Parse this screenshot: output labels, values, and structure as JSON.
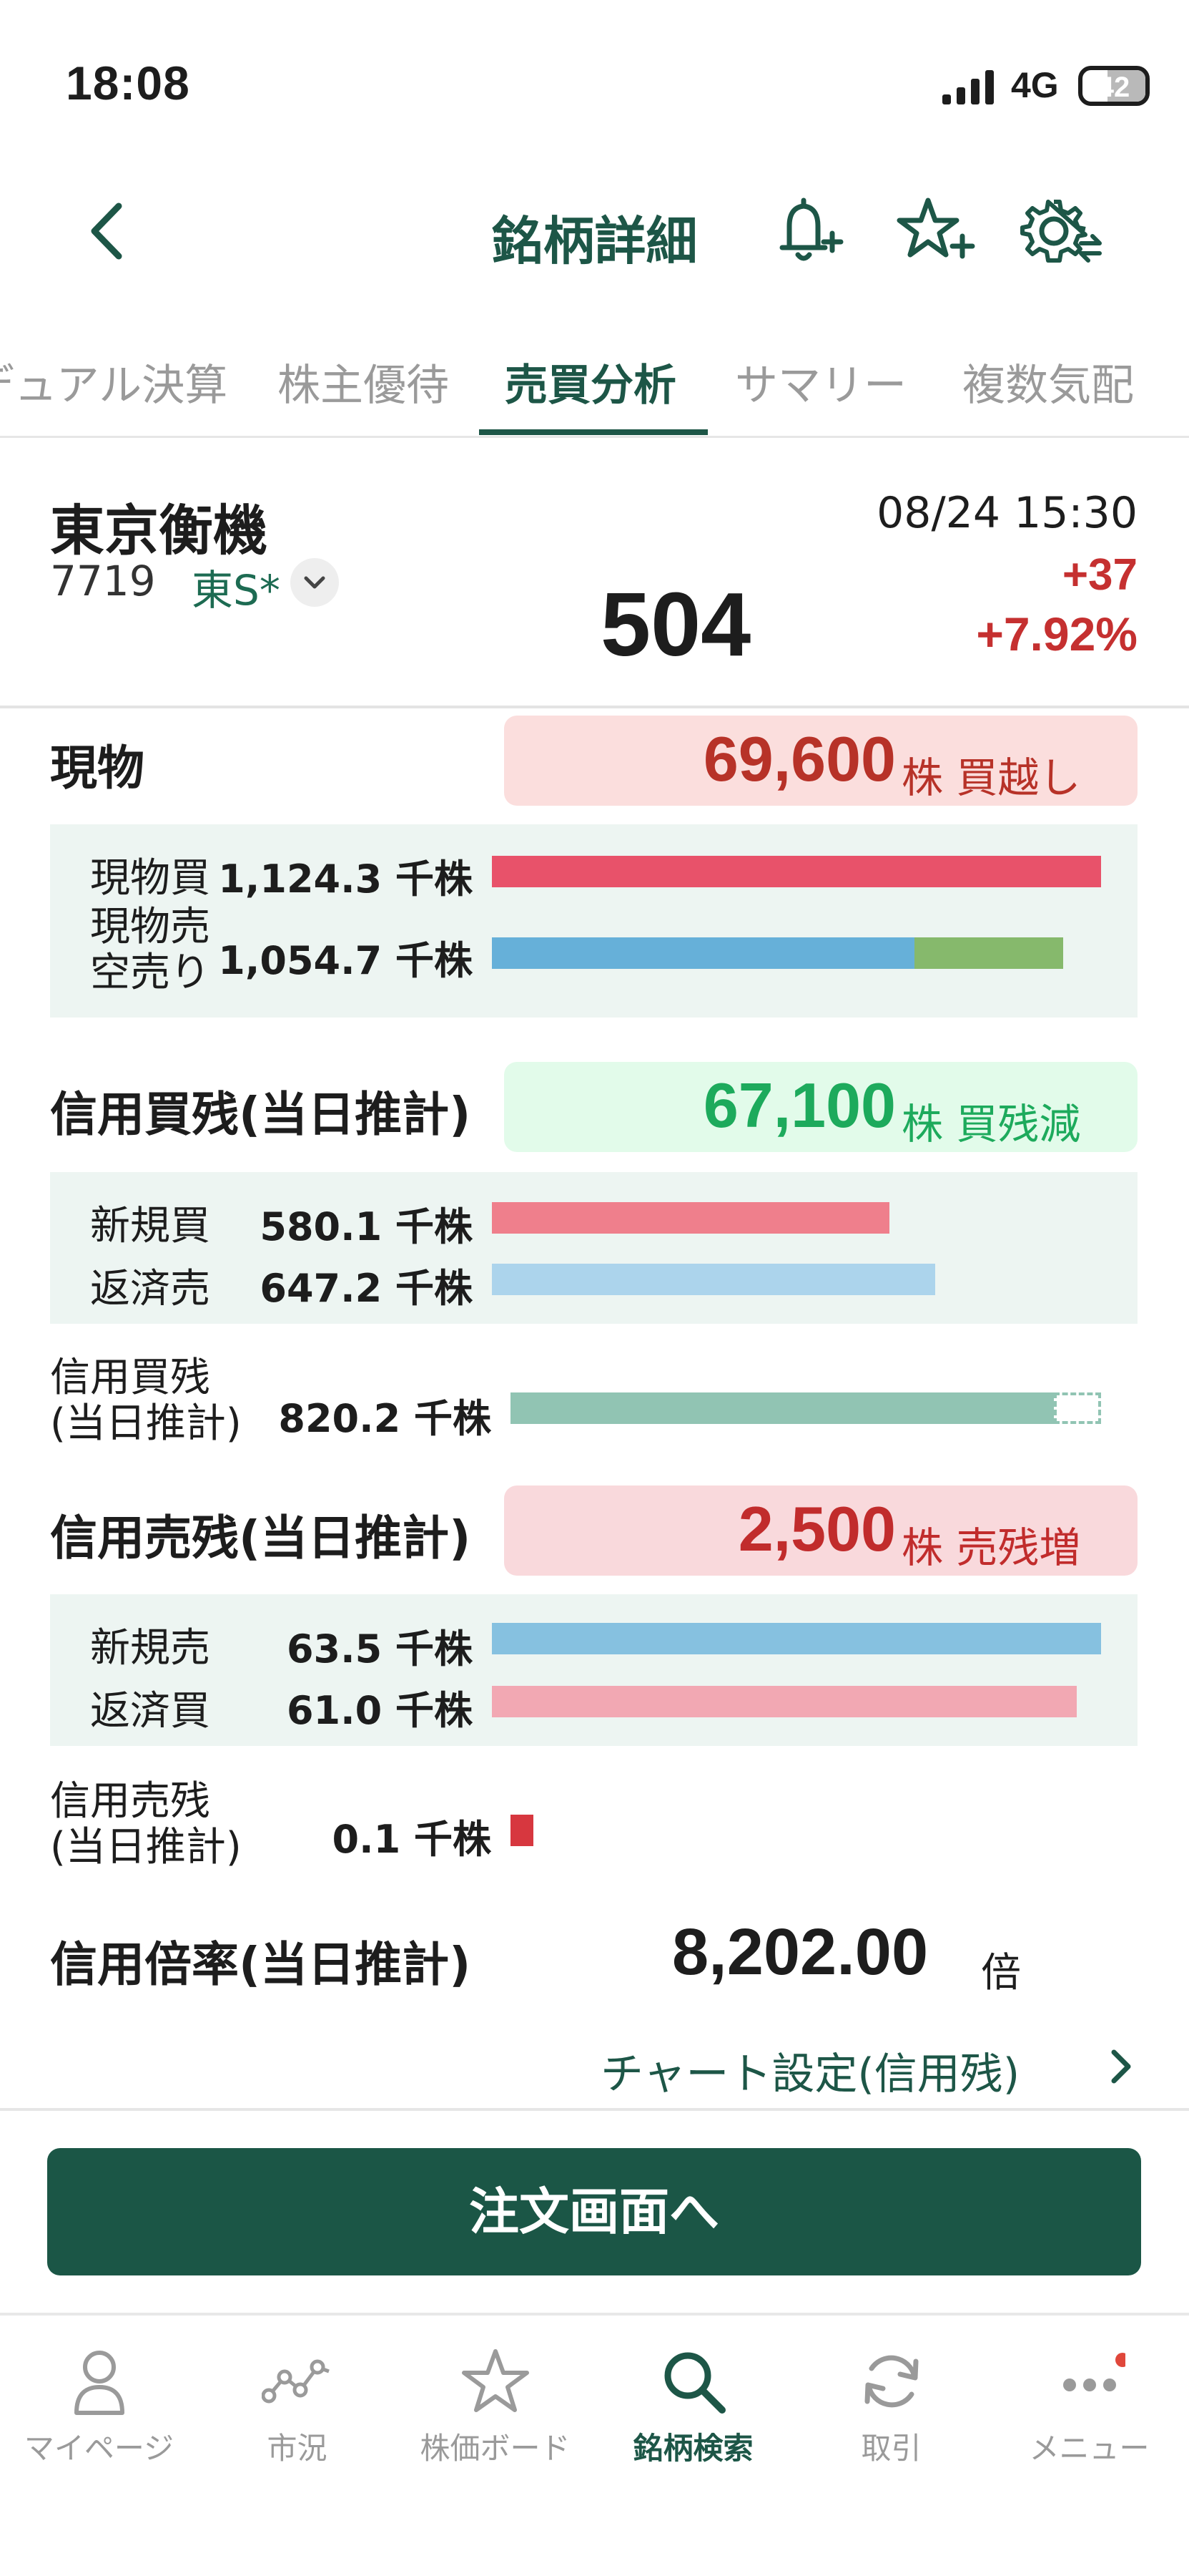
{
  "status_bar": {
    "time": "18:08",
    "network": "4G",
    "battery": "42"
  },
  "header": {
    "title": "銘柄詳細"
  },
  "tabs": [
    {
      "label": "デュアル決算"
    },
    {
      "label": "株主優待"
    },
    {
      "label": "売買分析",
      "active": true
    },
    {
      "label": "サマリー"
    },
    {
      "label": "複数気配"
    }
  ],
  "stock": {
    "name": "東京衡機",
    "code": "7719",
    "market": "東S*",
    "datetime": "08/24 15:30",
    "price": "504",
    "change": "+37",
    "change_pct": "+7.92%"
  },
  "genbutsu": {
    "title": "現物",
    "net_value": "69,600",
    "net_unit": "株 買越し",
    "rows": [
      {
        "label": "現物買",
        "value": "1,124.3 千株",
        "fraction": 1.0,
        "color": "#e8526a"
      },
      {
        "label_line1": "現物売",
        "label_line2": "空売り",
        "value": "1,054.7 千株",
        "fraction": 0.938,
        "split": 0.74,
        "color": "#66b0d9",
        "color2": "#86b96c"
      }
    ]
  },
  "shinyo_kai": {
    "title": "信用買残(当日推計)",
    "net_value": "67,100",
    "net_unit": "株 買残減",
    "rows": [
      {
        "label": "新規買",
        "value": "580.1 千株",
        "fraction": 0.652,
        "color": "#ef7f8c"
      },
      {
        "label": "返済売",
        "value": "647.2 千株",
        "fraction": 0.728,
        "color": "#acd4ec"
      }
    ],
    "balance": {
      "label_line1": "信用買残",
      "label_line2": "(当日推計)",
      "value": "820.2 千株",
      "fraction": 0.92,
      "color": "#91c4b3"
    }
  },
  "shinyo_uri": {
    "title": "信用売残(当日推計)",
    "net_value": "2,500",
    "net_unit": "株 売残増",
    "rows": [
      {
        "label": "新規売",
        "value": "63.5 千株",
        "fraction": 1.0,
        "color": "#86c1e0"
      },
      {
        "label": "返済買",
        "value": "61.0 千株",
        "fraction": 0.96,
        "color": "#f2a8b3"
      }
    ],
    "balance": {
      "label_line1": "信用売残",
      "label_line2": "(当日推計)",
      "value": "0.1 千株",
      "color": "#d7373f"
    }
  },
  "ratio": {
    "title": "信用倍率(当日推計)",
    "value": "8,202.00",
    "unit": "倍"
  },
  "chart_link": {
    "label": "チャート設定(信用残)"
  },
  "order_button": {
    "label": "注文画面へ"
  },
  "bottom_nav": [
    {
      "label": "マイページ",
      "icon": "person-icon"
    },
    {
      "label": "市況",
      "icon": "market-graph-icon"
    },
    {
      "label": "株価ボード",
      "icon": "star-icon"
    },
    {
      "label": "銘柄検索",
      "icon": "search-icon",
      "active": true
    },
    {
      "label": "取引",
      "icon": "refresh-icon"
    },
    {
      "label": "メニュー",
      "icon": "more-icon",
      "badge": true
    }
  ],
  "colors": {
    "accent": "#1d5647",
    "up": "#c53030",
    "button": "#1b5646"
  }
}
